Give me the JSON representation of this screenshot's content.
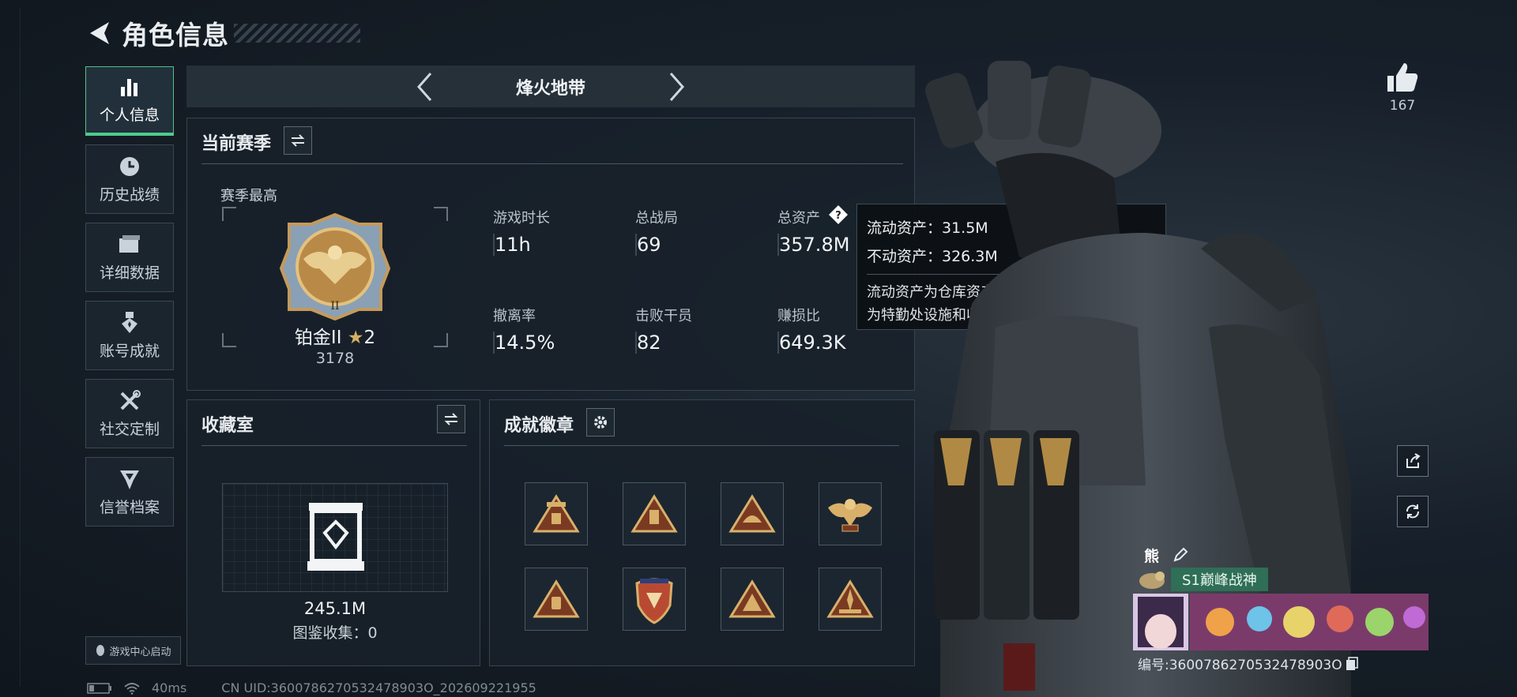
{
  "header": {
    "title": "角色信息"
  },
  "sidebar": {
    "items": [
      {
        "label": "个人信息",
        "icon": "bar-chart-icon",
        "active": true
      },
      {
        "label": "历史战绩",
        "icon": "clock-icon",
        "active": false
      },
      {
        "label": "详细数据",
        "icon": "folder-icon",
        "active": false
      },
      {
        "label": "账号成就",
        "icon": "medal-icon",
        "active": false
      },
      {
        "label": "社交定制",
        "icon": "tools-icon",
        "active": false
      },
      {
        "label": "信誉档案",
        "icon": "emblem-icon",
        "active": false
      }
    ],
    "launch_label": "游戏中心启动"
  },
  "mode": {
    "title": "烽火地带"
  },
  "season": {
    "title": "当前赛季",
    "best_label": "赛季最高",
    "rank_name": "铂金II",
    "rank_stars": "2",
    "rank_points": "3178",
    "stats": [
      {
        "label": "游戏时长",
        "value": "11h"
      },
      {
        "label": "总战局",
        "value": "69"
      },
      {
        "label": "总资产",
        "value": "357.8M"
      },
      {
        "label": "撤离率",
        "value": "14.5%"
      },
      {
        "label": "击败干员",
        "value": "82"
      },
      {
        "label": "赚损比",
        "value": "649.3K"
      }
    ]
  },
  "tooltip": {
    "line1": "流动资产：31.5M",
    "line2": "不动资产：326.3M",
    "desc1": "流动资产为仓库资产和哈夫币，不动资产",
    "desc2": "为特勤处设施和收藏室设施"
  },
  "collection": {
    "title": "收藏室",
    "value": "245.1M",
    "count_label": "图鉴收集：0"
  },
  "achievements": {
    "title": "成就徽章",
    "badge_count": 8
  },
  "status": {
    "ping": "40ms",
    "uid": "CN UID:3600786270532478903O_202609221955"
  },
  "profile": {
    "likes": "167",
    "name": "熊",
    "title_tag": "S1巅峰战神",
    "id_label": "编号:3600786270532478903O"
  },
  "colors": {
    "accent": "#4ecb8d",
    "gold": "#c9a253",
    "tag_green": "#2f6e57"
  }
}
